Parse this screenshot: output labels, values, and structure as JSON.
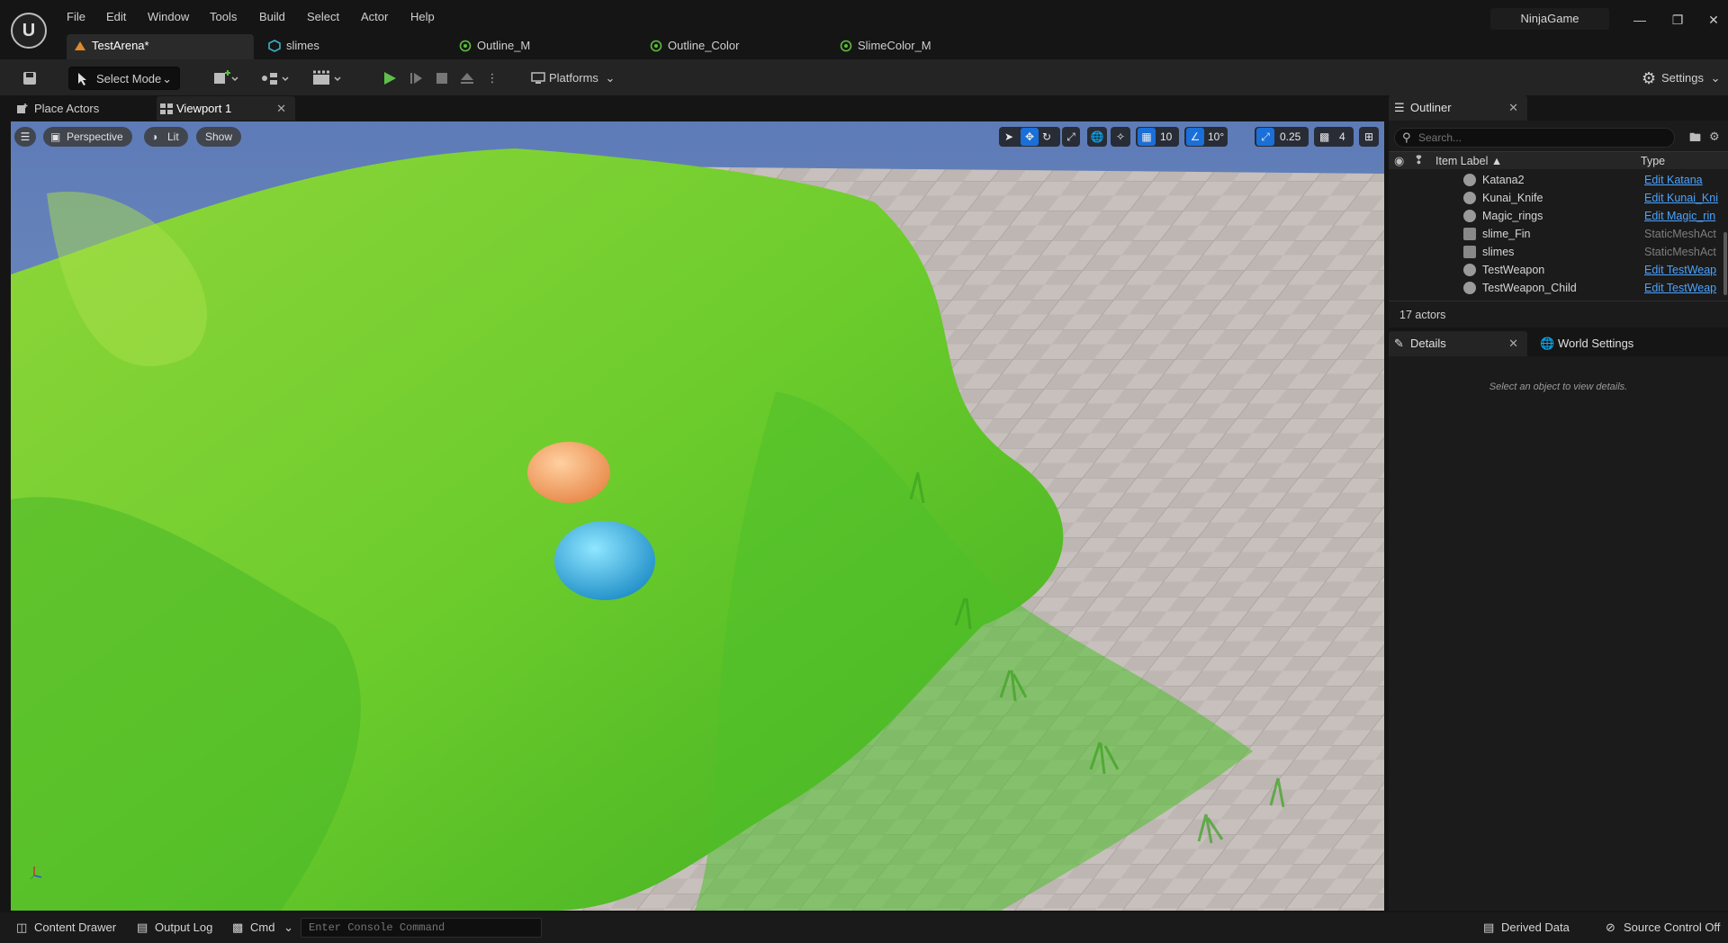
{
  "app": {
    "project_name": "NinjaGame"
  },
  "menu": [
    "File",
    "Edit",
    "Window",
    "Tools",
    "Build",
    "Select",
    "Actor",
    "Help"
  ],
  "doc_tabs": [
    {
      "label": "TestArena*",
      "icon": "level-icon"
    },
    {
      "label": "slimes",
      "icon": "static-mesh-icon"
    },
    {
      "label": "Outline_M",
      "icon": "material-icon"
    },
    {
      "label": "Outline_Color",
      "icon": "material-icon"
    },
    {
      "label": "SlimeColor_M",
      "icon": "material-icon"
    }
  ],
  "toolbar": {
    "select_mode": "Select Mode",
    "platforms": "Platforms",
    "settings": "Settings"
  },
  "panels": {
    "place_actors": "Place Actors",
    "viewport": "Viewport 1"
  },
  "viewport": {
    "perspective": "Perspective",
    "lit": "Lit",
    "show": "Show",
    "grid_snap": "10",
    "rot_snap": "10°",
    "scale_snap": "0.25",
    "camera_speed": "4"
  },
  "outliner": {
    "title": "Outliner",
    "search_placeholder": "Search...",
    "col_label": "Item Label ▲",
    "col_type": "Type",
    "rows": [
      {
        "label": "Katana2",
        "type": "Edit Katana",
        "link": true
      },
      {
        "label": "Kunai_Knife",
        "type": "Edit Kunai_Kni",
        "link": true
      },
      {
        "label": "Magic_rings",
        "type": "Edit Magic_rin",
        "link": true
      },
      {
        "label": "slime_Fin",
        "type": "StaticMeshAct",
        "link": false
      },
      {
        "label": "slimes",
        "type": "StaticMeshAct",
        "link": false
      },
      {
        "label": "TestWeapon",
        "type": "Edit TestWeap",
        "link": true
      },
      {
        "label": "TestWeapon_Child",
        "type": "Edit TestWeap",
        "link": true
      }
    ],
    "count": "17 actors"
  },
  "details": {
    "title": "Details",
    "world_settings": "World Settings",
    "empty": "Select an object to view details."
  },
  "statusbar": {
    "content_drawer": "Content Drawer",
    "output_log": "Output Log",
    "cmd": "Cmd",
    "console_placeholder": "Enter Console Command",
    "derived_data": "Derived Data",
    "source_control": "Source Control Off"
  }
}
